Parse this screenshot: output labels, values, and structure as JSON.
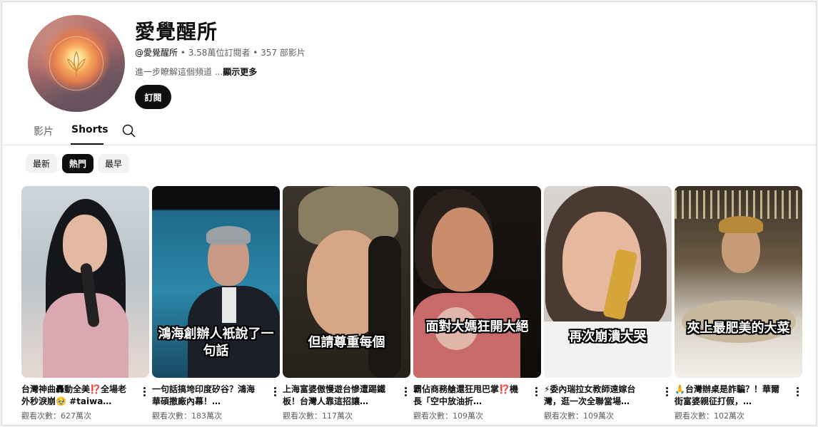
{
  "channel": {
    "title": "愛覺醒所",
    "handle": "@愛覺醒所",
    "meta": " • 3.58萬位訂閱者 • 357 部影片",
    "description": "進一步瞭解這個頻道 ...",
    "more": "顯示更多",
    "subscribe_label": "訂閱"
  },
  "tabs": [
    {
      "label": "影片"
    },
    {
      "label": "Shorts",
      "active": true
    }
  ],
  "chips": [
    {
      "label": "最新"
    },
    {
      "label": "熱門",
      "active": true
    },
    {
      "label": "最早"
    }
  ],
  "shorts": [
    {
      "title": "台灣神曲轟動全美⁉️全場老外秒淚崩🥹 #taiwa…",
      "views": "觀看次數：627萬次",
      "caption": ""
    },
    {
      "title": "一句話搞垮印度矽谷？鴻海華碩撤廠內幕！…",
      "views": "觀看次數：183萬次",
      "caption": "鴻海創辦人衹說了一句話"
    },
    {
      "title": "上海富婆傲慢遊台慘遭踢鐵板！台灣人靠這招讓…",
      "views": "觀看次數：117萬次",
      "caption": "但請尊重每個"
    },
    {
      "title": "霸佔商務艙還狂甩巴掌⁉️機長「空中放油折…",
      "views": "觀看次數：109萬次",
      "caption": "面對大媽狂開大絕"
    },
    {
      "title": "⚡委內瑞拉女教師遠嫁台灣，逛一次全聯當場…",
      "views": "觀看次數：109萬次",
      "caption": "再次崩潰大哭"
    },
    {
      "title": "🙏台灣辦桌是詐騙？！華爾街富婆親征打假，…",
      "views": "觀看次數：102萬次",
      "caption": "夾上最肥美的大菜"
    }
  ]
}
